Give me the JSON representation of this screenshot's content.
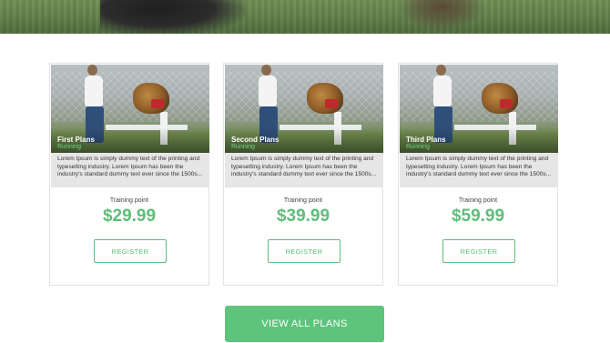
{
  "plans": [
    {
      "name": "First Plans",
      "tag": "Running",
      "description": "Lorem Ipsum is simply dummy text of the printing and typesetting industry. Lorem Ipsum has been the industry's standard dummy text ever since the 1500s...",
      "price_label": "Training point",
      "price": "$29.99",
      "register_label": "REGISTER"
    },
    {
      "name": "Second Plans",
      "tag": "Running",
      "description": "Lorem Ipsum is simply dummy text of the printing and typesetting industry. Lorem Ipsum has been the industry's standard dummy text ever since the 1500s...",
      "price_label": "Training point",
      "price": "$39.99",
      "register_label": "REGISTER"
    },
    {
      "name": "Third Plans",
      "tag": "Running",
      "description": "Lorem Ipsum is simply dummy text of the printing and typesetting industry. Lorem Ipsum has been the industry's standard dummy text ever since the 1500s...",
      "price_label": "Training point",
      "price": "$59.99",
      "register_label": "REGISTER"
    }
  ],
  "view_all_label": "VIEW ALL PLANS",
  "colors": {
    "accent": "#5dbe78",
    "button_bg": "#5ec47c",
    "desc_bg": "#e6e6e6"
  }
}
